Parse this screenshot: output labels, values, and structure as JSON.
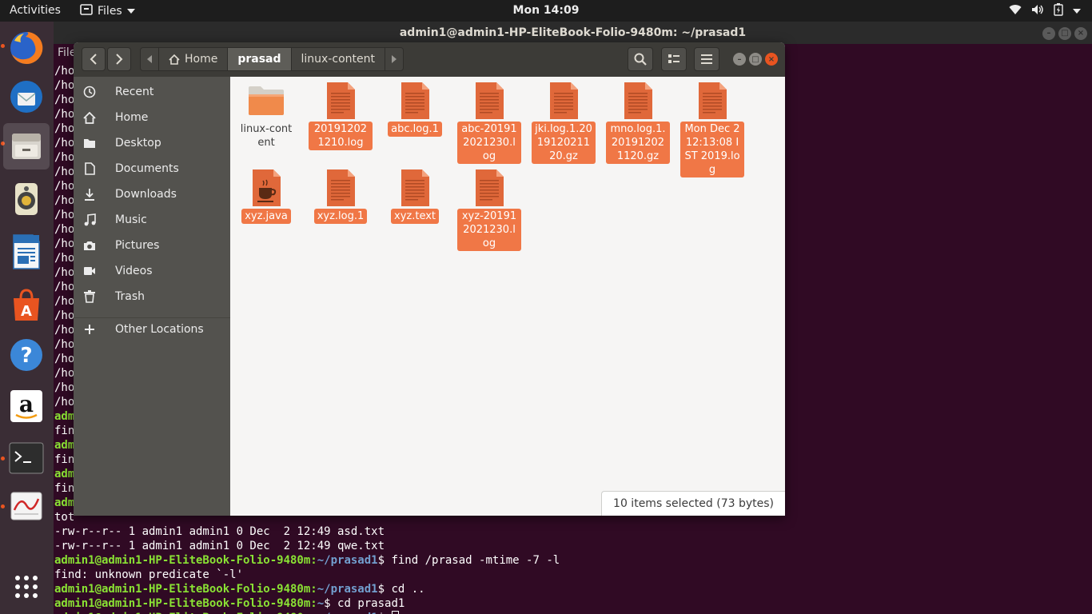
{
  "topbar": {
    "activities": "Activities",
    "app_name": "Files",
    "clock": "Mon 14:09"
  },
  "dock": {
    "apps": [
      "firefox-icon",
      "thunderbird-icon",
      "files-icon",
      "rhythmbox-icon",
      "libreoffice-writer-icon",
      "software-center-icon",
      "help-icon",
      "amazon-icon",
      "terminal-icon",
      "system-monitor-icon",
      "show-apps-icon"
    ]
  },
  "terminal": {
    "title": "admin1@admin1-HP-EliteBook-Folio-9480m: ~/prasad1",
    "menu": "File",
    "hidden_lines": [
      "/ho",
      "/ho",
      "/ho",
      "/ho",
      "/ho",
      "/ho",
      "/ho",
      "/ho",
      "/ho",
      "/ho",
      "/ho",
      "/ho",
      "/ho",
      "/ho",
      "/ho",
      "/ho",
      "/ho",
      "/ho",
      "/ho",
      "/ho",
      "/ho",
      "/ho",
      "/ho",
      "/ho"
    ],
    "short_lines": [
      {
        "type": "prompt",
        "text": "adm"
      },
      {
        "type": "out",
        "text": "fin"
      },
      {
        "type": "prompt",
        "text": "adm"
      },
      {
        "type": "out",
        "text": "fin"
      },
      {
        "type": "prompt",
        "text": "adm"
      },
      {
        "type": "out",
        "text": "fin"
      },
      {
        "type": "prompt",
        "text": "adm"
      },
      {
        "type": "out",
        "text": "tot"
      }
    ],
    "full_lines": [
      {
        "type": "out",
        "text": "-rw-r--r-- 1 admin1 admin1 0 Dec  2 12:49 asd.txt"
      },
      {
        "type": "out",
        "text": "-rw-r--r-- 1 admin1 admin1 0 Dec  2 12:49 qwe.txt"
      },
      {
        "type": "prompt",
        "user": "admin1@admin1-HP-EliteBook-Folio-9480m",
        "path": "~/prasad1",
        "cmd": "find /prasad -mtime -7 -l"
      },
      {
        "type": "out",
        "text": "find: unknown predicate `-l'"
      },
      {
        "type": "prompt",
        "user": "admin1@admin1-HP-EliteBook-Folio-9480m",
        "path": "~/prasad1",
        "cmd": "cd .."
      },
      {
        "type": "prompt",
        "user": "admin1@admin1-HP-EliteBook-Folio-9480m",
        "path": "~",
        "cmd": "cd prasad1"
      },
      {
        "type": "prompt",
        "user": "admin1@admin1-HP-EliteBook-Folio-9480m",
        "path": "~/prasad1",
        "cmd": ""
      }
    ]
  },
  "files": {
    "path": {
      "home": "Home",
      "current": "prasad",
      "child": "linux-content"
    },
    "sidebar": [
      {
        "label": "Recent",
        "icon": "clock-icon"
      },
      {
        "label": "Home",
        "icon": "home-icon"
      },
      {
        "label": "Desktop",
        "icon": "folder-icon"
      },
      {
        "label": "Documents",
        "icon": "document-icon"
      },
      {
        "label": "Downloads",
        "icon": "download-icon"
      },
      {
        "label": "Music",
        "icon": "music-icon"
      },
      {
        "label": "Pictures",
        "icon": "camera-icon"
      },
      {
        "label": "Videos",
        "icon": "video-icon"
      },
      {
        "label": "Trash",
        "icon": "trash-icon"
      },
      {
        "label": "Other Locations",
        "icon": "plus-icon"
      }
    ],
    "items": [
      {
        "name": "linux-content",
        "kind": "folder",
        "selected": false
      },
      {
        "name": "201912021210.log",
        "kind": "text",
        "selected": true
      },
      {
        "name": "abc.log.1",
        "kind": "text",
        "selected": true
      },
      {
        "name": "abc-201912021230.log",
        "kind": "text",
        "selected": true
      },
      {
        "name": "jki.log.1.201912021120.gz",
        "kind": "text",
        "selected": true
      },
      {
        "name": "mno.log.1.201912021120.gz",
        "kind": "text",
        "selected": true
      },
      {
        "name": "Mon Dec  2 12:13:08 IST 2019.log",
        "kind": "text",
        "selected": true
      },
      {
        "name": "xyz.java",
        "kind": "java",
        "selected": true
      },
      {
        "name": "xyz.log.1",
        "kind": "text",
        "selected": true
      },
      {
        "name": "xyz.text",
        "kind": "text",
        "selected": true
      },
      {
        "name": "xyz-201912021230.log",
        "kind": "text",
        "selected": true
      }
    ],
    "status": "10 items selected (73 bytes)"
  },
  "colors": {
    "accent": "#e95420",
    "selection": "#f07746",
    "terminal_bg": "#300a24",
    "prompt_user": "#8ae234",
    "prompt_path": "#729fcf"
  }
}
